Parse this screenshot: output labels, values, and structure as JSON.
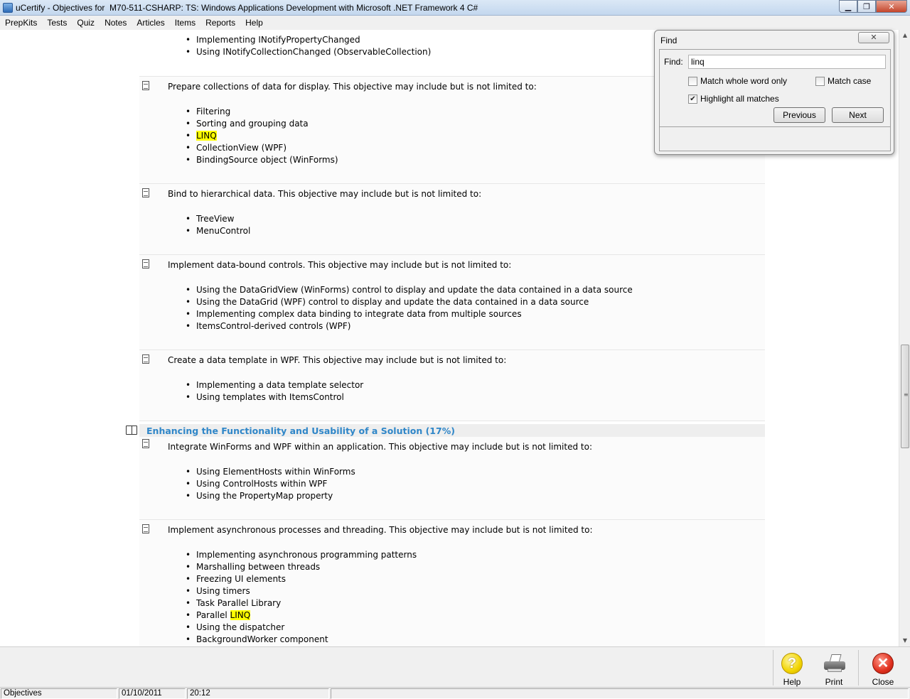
{
  "window": {
    "title": "uCertify - Objectives for  M70-511-CSHARP: TS: Windows Applications Development with Microsoft .NET Framework 4 C#",
    "min_symbol": "▁",
    "max_symbol": "❐",
    "close_symbol": "✕"
  },
  "menu": [
    "PrepKits",
    "Tests",
    "Quiz",
    "Notes",
    "Articles",
    "Items",
    "Reports",
    "Help"
  ],
  "objectives_top": {
    "items": [
      "Implementing INotifyPropertyChanged",
      "Using INotifyCollectionChanged (ObservableCollection)"
    ]
  },
  "objectives": [
    {
      "lead": "Prepare collections of data for display. This objective may include but is not limited to:",
      "items": [
        "Filtering",
        "Sorting and grouping data",
        "LINQ",
        "CollectionView (WPF)",
        "BindingSource object (WinForms)"
      ]
    },
    {
      "lead": "Bind to hierarchical data. This objective may include but is not limited to:",
      "items": [
        "TreeView",
        "MenuControl"
      ]
    },
    {
      "lead": "Implement data-bound controls. This objective may include but is not limited to:",
      "items": [
        "Using the DataGridView (WinForms) control to display and update the data contained in a data source",
        "Using the DataGrid (WPF) control to display and update the data contained in a data source",
        "Implementing complex data binding to integrate data from multiple sources",
        "ItemsControl-derived controls (WPF)"
      ]
    },
    {
      "lead": "Create a data template in WPF. This objective may include but is not limited to:",
      "items": [
        "Implementing a data template selector",
        "Using templates with ItemsControl"
      ]
    },
    {
      "lead": "Integrate WinForms and WPF within an application. This objective may include but is not limited to:",
      "items": [
        "Using ElementHosts within WinForms",
        "Using ControlHosts within WPF",
        "Using the PropertyMap property"
      ]
    },
    {
      "lead": "Implement asynchronous processes and threading. This objective may include but is not limited to:",
      "items": [
        "Implementing asynchronous programming patterns",
        "Marshalling between threads",
        "Freezing UI elements",
        "Using timers",
        "Task Parallel Library",
        "Parallel LINQ",
        "Using the dispatcher",
        "BackgroundWorker component"
      ]
    }
  ],
  "section": {
    "title": "Enhancing the Functionality and Usability of a Solution (17%)"
  },
  "highlight_term": "LINQ",
  "find_dialog": {
    "title": "Find",
    "close_symbol": "✕",
    "find_label": "Find:",
    "query": "linq",
    "match_whole_word_label": "Match whole word only",
    "match_whole_word_checked": false,
    "match_case_label": "Match case",
    "match_case_checked": false,
    "highlight_all_label": "Highlight all matches",
    "highlight_all_checked": true,
    "previous_label": "Previous",
    "next_label": "Next"
  },
  "toolbar": {
    "help_label": "Help",
    "help_glyph": "?",
    "print_label": "Print",
    "close_label": "Close",
    "close_glyph": "✕"
  },
  "status": {
    "section": "Objectives",
    "date": "01/10/2011",
    "time": "20:12"
  },
  "colors": {
    "section_title": "#2f86c8",
    "highlight": "#ffff00"
  }
}
